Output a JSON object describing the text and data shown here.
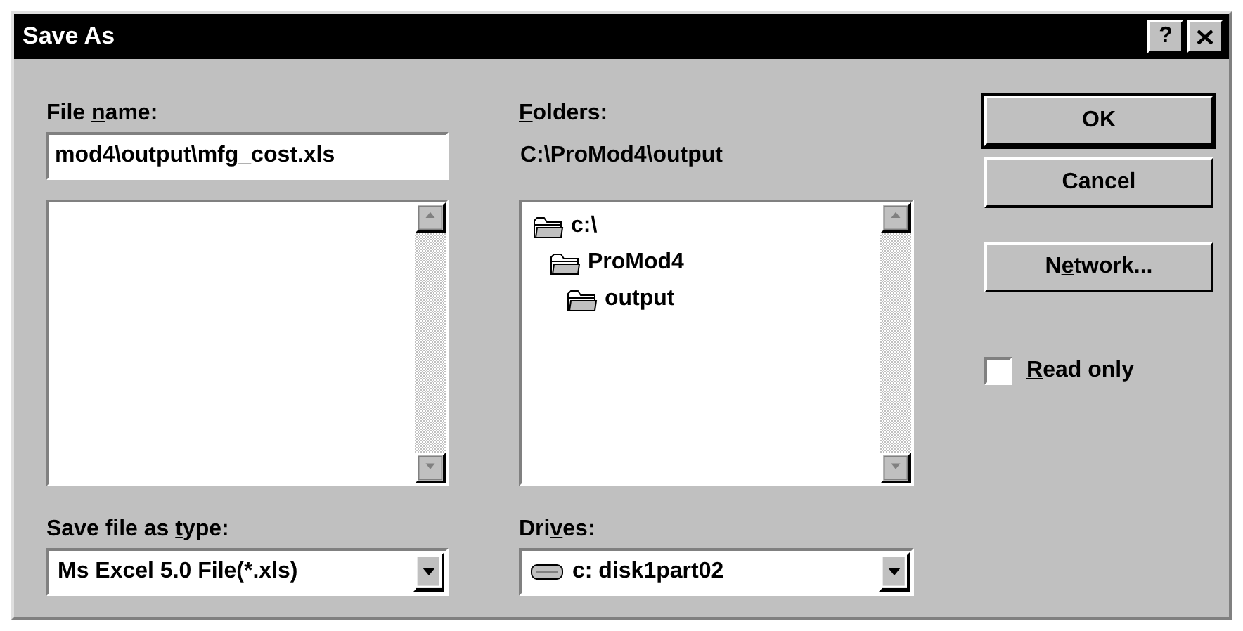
{
  "window": {
    "title": "Save As",
    "help_button": "?"
  },
  "file_name": {
    "label_parts": [
      {
        "text": "File ",
        "underlined": false
      },
      {
        "text": "n",
        "underlined": true
      },
      {
        "text": "ame:",
        "underlined": false
      }
    ],
    "value": "mod4\\output\\mfg_cost.xls"
  },
  "folders": {
    "label_parts": [
      {
        "text": "F",
        "underlined": true
      },
      {
        "text": "olders:",
        "underlined": false
      }
    ],
    "path": "C:\\ProMod4\\output",
    "tree": [
      {
        "name": "c:\\",
        "children": [
          {
            "name": "ProMod4",
            "children": [
              {
                "name": "output"
              }
            ]
          }
        ]
      }
    ]
  },
  "buttons": [
    {
      "label_parts": [
        {
          "text": "OK",
          "underlined": false
        }
      ],
      "default": true
    },
    {
      "label_parts": [
        {
          "text": "Cancel",
          "underlined": false
        }
      ],
      "default": false
    },
    {
      "label_parts": [
        {
          "text": "N",
          "underlined": false
        },
        {
          "text": "e",
          "underlined": true
        },
        {
          "text": "twork...",
          "underlined": false
        }
      ],
      "default": false
    }
  ],
  "read_only": {
    "label_parts": [
      {
        "text": "R",
        "underlined": true
      },
      {
        "text": "ead only",
        "underlined": false
      }
    ],
    "checked": false
  },
  "save_type": {
    "label_parts": [
      {
        "text": "Save file as ",
        "underlined": false
      },
      {
        "text": "t",
        "underlined": true
      },
      {
        "text": "ype:",
        "underlined": false
      }
    ],
    "value": "Ms Excel 5.0 File(*.xls)"
  },
  "drives": {
    "label_parts": [
      {
        "text": "Dri",
        "underlined": false
      },
      {
        "text": "v",
        "underlined": true
      },
      {
        "text": "es:",
        "underlined": false
      }
    ],
    "value": "c: disk1part02"
  }
}
